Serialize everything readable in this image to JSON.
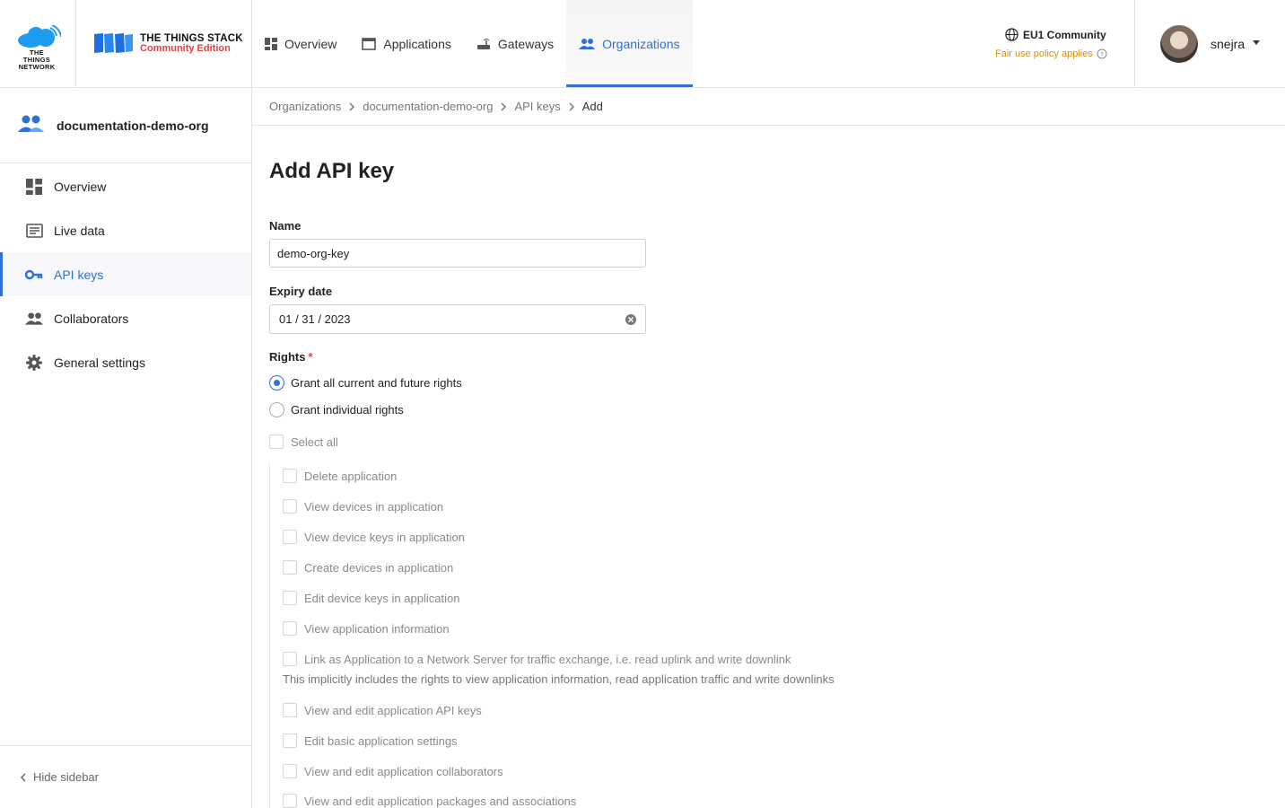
{
  "header": {
    "ttn_logo_text": [
      "THE THINGS",
      "NETWORK"
    ],
    "tts_title": "THE THINGS STACK",
    "tts_edition": "Community Edition",
    "nav": [
      {
        "label": "Overview",
        "icon": "dashboard-icon"
      },
      {
        "label": "Applications",
        "icon": "application-icon"
      },
      {
        "label": "Gateways",
        "icon": "gateway-icon"
      },
      {
        "label": "Organizations",
        "icon": "organization-icon",
        "active": true
      }
    ],
    "cluster": {
      "name": "EU1 Community",
      "policy": "Fair use policy applies"
    },
    "user": {
      "name": "snejra"
    }
  },
  "sidebar": {
    "org_name": "documentation-demo-org",
    "items": [
      {
        "label": "Overview",
        "icon": "dashboard-icon"
      },
      {
        "label": "Live data",
        "icon": "live-data-icon"
      },
      {
        "label": "API keys",
        "icon": "key-icon",
        "active": true
      },
      {
        "label": "Collaborators",
        "icon": "collaborators-icon"
      },
      {
        "label": "General settings",
        "icon": "gear-icon"
      }
    ],
    "hide_label": "Hide sidebar"
  },
  "breadcrumb": [
    "Organizations",
    "documentation-demo-org",
    "API keys",
    "Add"
  ],
  "form": {
    "title": "Add API key",
    "name_label": "Name",
    "name_value": "demo-org-key",
    "expiry_label": "Expiry date",
    "expiry_value": "01 / 31 / 2023",
    "rights_label": "Rights",
    "rights_required": "*",
    "grant_all": "Grant all current and future rights",
    "grant_individual": "Grant individual rights",
    "select_all": "Select all",
    "rights": [
      "Delete application",
      "View devices in application",
      "View device keys in application",
      "Create devices in application",
      "Edit device keys in application",
      "View application information",
      "Link as Application to a Network Server for traffic exchange, i.e. read uplink and write downlink",
      "View and edit application API keys",
      "Edit basic application settings",
      "View and edit application collaborators",
      "View and edit application packages and associations"
    ],
    "link_hint": "This implicitly includes the rights to view application information, read application traffic and write downlinks"
  },
  "colors": {
    "accent": "#2f6fd6",
    "warning": "#d6900c",
    "required": "#e14141"
  }
}
